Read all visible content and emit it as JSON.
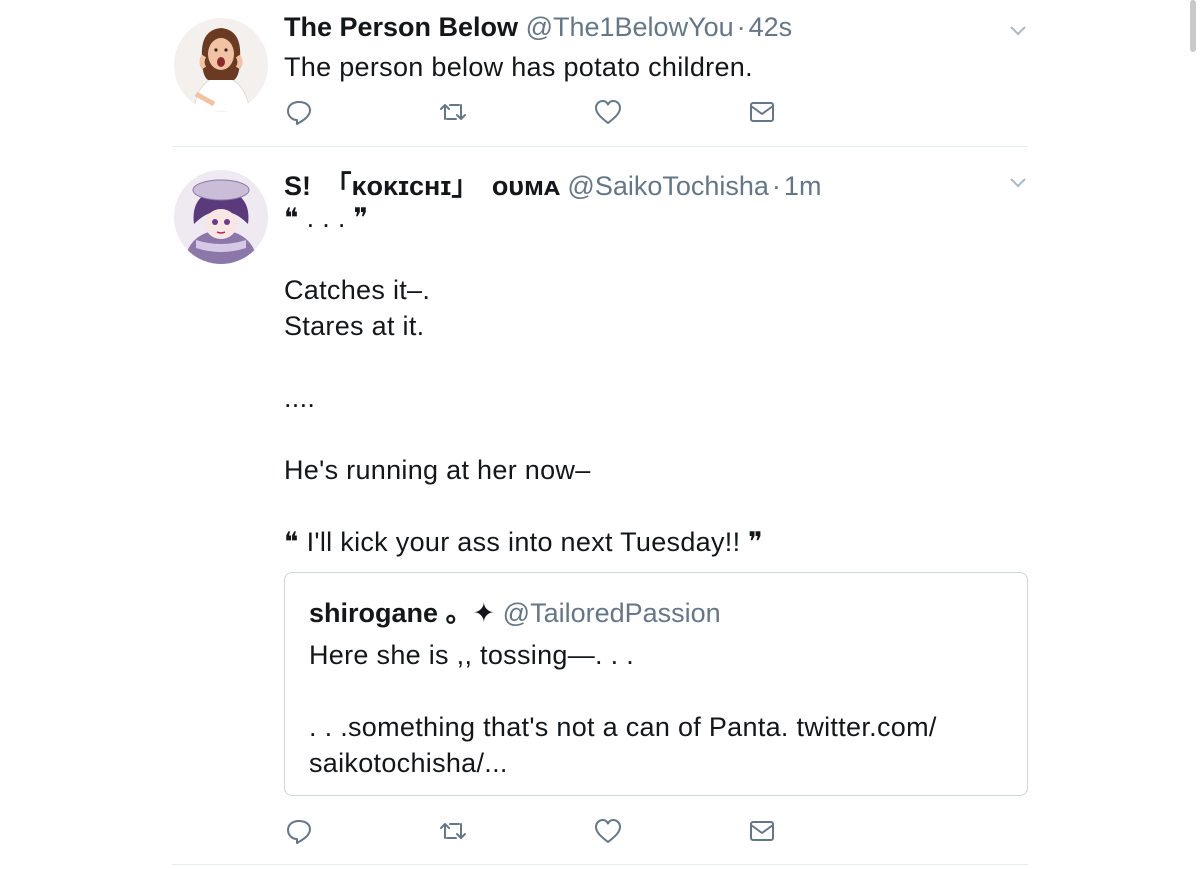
{
  "tweets": [
    {
      "name": "The Person Below",
      "handle": "@The1BelowYou",
      "separator": "·",
      "time": "42s",
      "text": "The person below has potato children.",
      "avatar_icon": "surprised-woman-avatar"
    },
    {
      "name": "S!　「kokichi』　ouma",
      "name_display": "S!　「ᴋᴏᴋɪᴄʜɪ」　ᴏᴜᴍᴀ",
      "handle": "@SaikoTochisha",
      "separator": "·",
      "time": "1m",
      "text": "❝ . . . ❞\n\nCatches it–.\nStares at it.\n\n....\n\nHe's running at her now–\n\n❝ I'll kick your ass into next Tuesday!! ❞",
      "avatar_icon": "anime-character-avatar",
      "quote": {
        "name": "shirogane 。✦",
        "handle": "@TailoredPassion",
        "text": "Here she is ,, tossing—. . .\n\n. . .something that's not a can of Panta. twitter.com/\nsaikotochisha/..."
      }
    }
  ],
  "actions": [
    "reply-icon",
    "retweet-icon",
    "like-icon",
    "direct-message-icon"
  ],
  "colors": {
    "text": "#14171a",
    "secondary": "#657786",
    "icon": "#657786",
    "border": "#e6ecf0",
    "quote_border": "#ccd6dd"
  }
}
